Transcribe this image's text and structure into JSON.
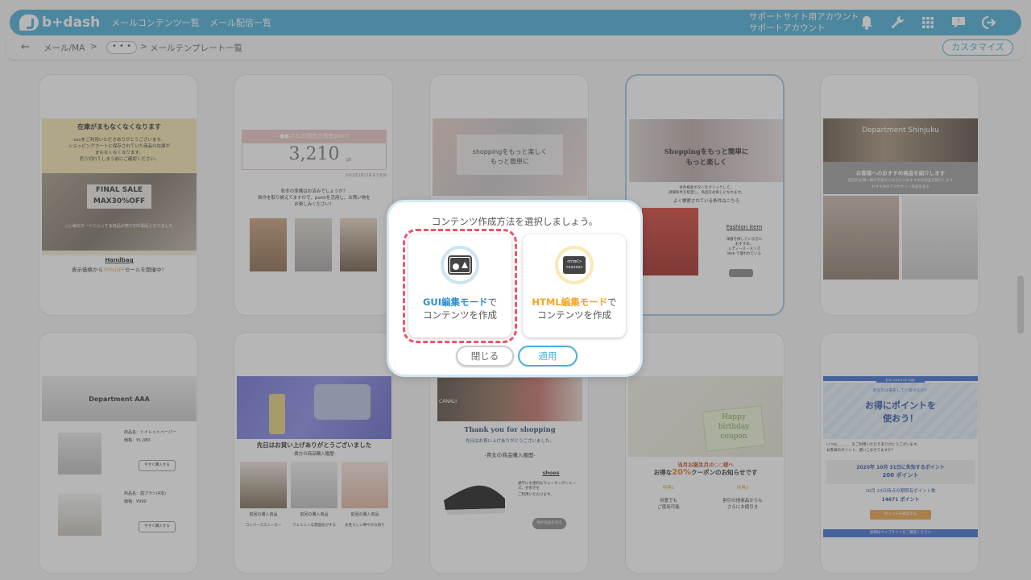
{
  "header": {
    "logo_text": "b+dash",
    "nav": [
      "メールコンテンツ一覧",
      "メール配信一覧"
    ],
    "account_line1": "サポートサイト用アカウント",
    "account_line2": "サポートアカウント",
    "icons": [
      "bell-icon",
      "wrench-icon",
      "grid-icon",
      "support-chat-icon",
      "logout-icon"
    ]
  },
  "breadcrumb": {
    "back": "←",
    "item1": "メール/MA",
    "sep": ">",
    "more": "• • •",
    "current": "メールテンプレート一覧"
  },
  "customize_label": "カスタマイズ",
  "cards": [
    {
      "lines": [
        "在庫がまもなくなくなります",
        "xxxをご利用いただきありがとうございます。",
        "ショッピングカートに保存されていた商品の在庫が",
        "まもなくなくなります。",
        "売り切れてしまう前にご確認ください。",
        "FINAL SALE",
        "MAX30%OFF",
        "○○様のカートに入ってる商品が売り切れ間近となりました",
        "Handbag",
        "表示価格から",
        "30%OFF",
        "セールを開催中！"
      ]
    },
    {
      "lines": [
        "●●さんの現在の保有point",
        "3,210",
        "pt",
        "2021年3月15日まで有効",
        "秋冬の準備はお済みでしょうか？",
        "新作を取り揃えてますので、pointを活用し、お買い物を",
        "お楽しみください！"
      ]
    },
    {
      "lines": [
        "shoppingをもっと楽しく",
        "もっと簡単に"
      ]
    },
    {
      "lines": [
        "Shoppingをもっと簡単に",
        "もっと楽しく",
        "条件検索ボタンをクリックして、",
        "詳細条件を指定し、商品をお探しになれます。",
        "よく検索されている条件はこちら",
        "Fashion item",
        "洋服を探している方に",
        "おすすめ。",
        "レディース・メンズ",
        "Web で使われている"
      ]
    },
    {
      "lines": [
        "Department Shinjuku",
        "お客様へのおすすめ商品を紹介します",
        "前回のお買い物の内容からあなたにおすすめの商品を紹介します",
        "おすすめのアクセサリー商品を見る"
      ]
    },
    {
      "lines": [
        "Department AAA",
        "商品名：トイレットペーパー",
        "価格：¥1,080",
        "今すぐ購入する",
        "商品名：歯ブラシ(4本)",
        "価格：¥990",
        "今すぐ購入する"
      ]
    },
    {
      "lines": [
        "先日はお買い上げありがとうございました",
        "-貴方の商品購入履歴-",
        "前回の購入商品",
        "前回の購入商品",
        "前回の購入商品",
        "コンバーススニーカー",
        "フェミニンな雰囲気がする",
        "女性らしい華やかな香り"
      ]
    },
    {
      "lines": [
        "Thank you for shopping",
        "先日はお買い上げありがとうございました。",
        "-貴女の商品購入履歴-",
        "shoes",
        "通学にも便利なウォーキングシューズ。外歩きを",
        "ご利用いただけます。",
        "他の商品を見る",
        "CANALI"
      ]
    },
    {
      "lines": [
        "Happy",
        "birthday",
        "coupon",
        "当月お誕生月の○○様へ",
        "お得な",
        "20%",
        "クーポンのお知らせです",
        "特典1",
        "特典2",
        "何度でも",
        "ご使用可能",
        "割引の他商品からも",
        "さらにお値引き"
      ]
    },
    {
      "lines": [
        "Join name on logo",
        "あなたは得をしていませんか？",
        "お得にポイントを",
        "使おう！",
        "いつも＿＿＿＿をご利用いただきありがとうございます。",
        "お客様のポイント、使いこなせてますか？",
        "2020年 10月 31日に失効するポイント",
        "200 ポイント",
        "10月 23日時点の期限有ポイント数",
        "14671 ポイント",
        "ポイントを確認する",
        "詳細はウェブサイトをご確認ください"
      ]
    }
  ],
  "modal": {
    "title": "コンテンツ作成方法を選択しましょう。",
    "gui_mode_highlight": "GUI編集モード",
    "gui_mode_suffix": "で",
    "gui_mode_line2": "コンテンツを作成",
    "html_mode_highlight": "HTML編集モード",
    "html_mode_suffix": "で",
    "html_mode_line2": "コンテンツを作成",
    "html_icon_text1": "<html>",
    "html_icon_text2": "<xxxxx>",
    "close_label": "閉じる",
    "apply_label": "適用"
  },
  "colors": {
    "brand": "#4aaed8",
    "gui_accent": "#2f8fd1",
    "html_accent": "#f5a623",
    "selected_outline": "#e95868"
  }
}
